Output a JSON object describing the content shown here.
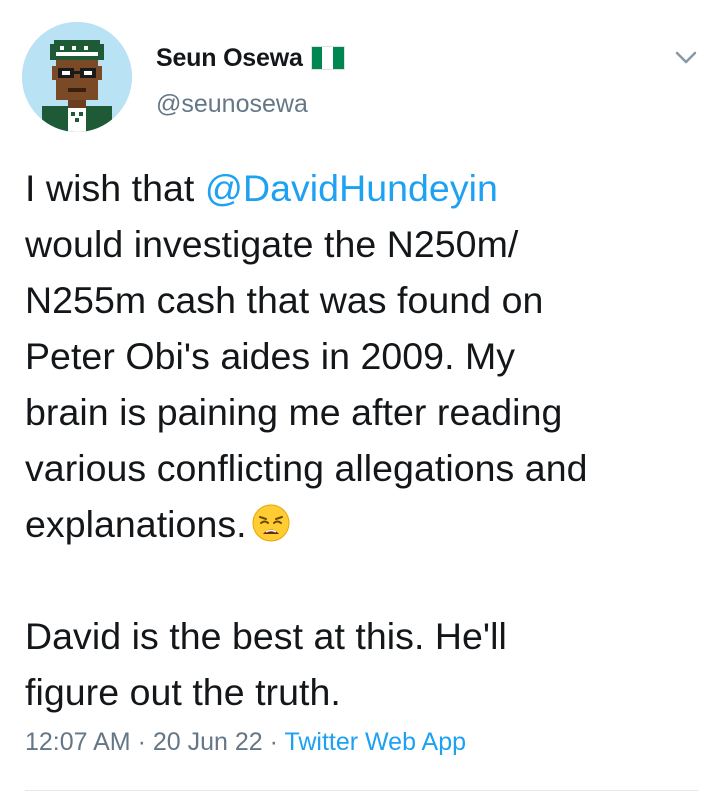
{
  "user": {
    "display_name": "Seun Osewa",
    "flag_icon": "nigeria-flag-icon",
    "handle": "@seunosewa",
    "avatar_icon": "pixel-avatar"
  },
  "menu": {
    "icon": "chevron-down-icon"
  },
  "tweet": {
    "line1_pre": "I wish that ",
    "mention": "@DavidHundeyin",
    "line2": "would investigate the N250m/",
    "line3": "N255m cash that was found on",
    "line4": "Peter Obi's aides in 2009. My",
    "line5": "brain is paining me after reading",
    "line6": "various conflicting allegations and",
    "line7": "explanations.",
    "emoji": "weary-face-emoji",
    "line8": "David is the best at this. He'll",
    "line9": "figure out the truth."
  },
  "meta": {
    "time": "12:07 AM",
    "sep1": " · ",
    "date": "20 Jun 22",
    "sep2": " · ",
    "source": "Twitter Web App"
  },
  "colors": {
    "link": "#1da1f2",
    "secondary": "#657786",
    "text": "#14171a"
  }
}
